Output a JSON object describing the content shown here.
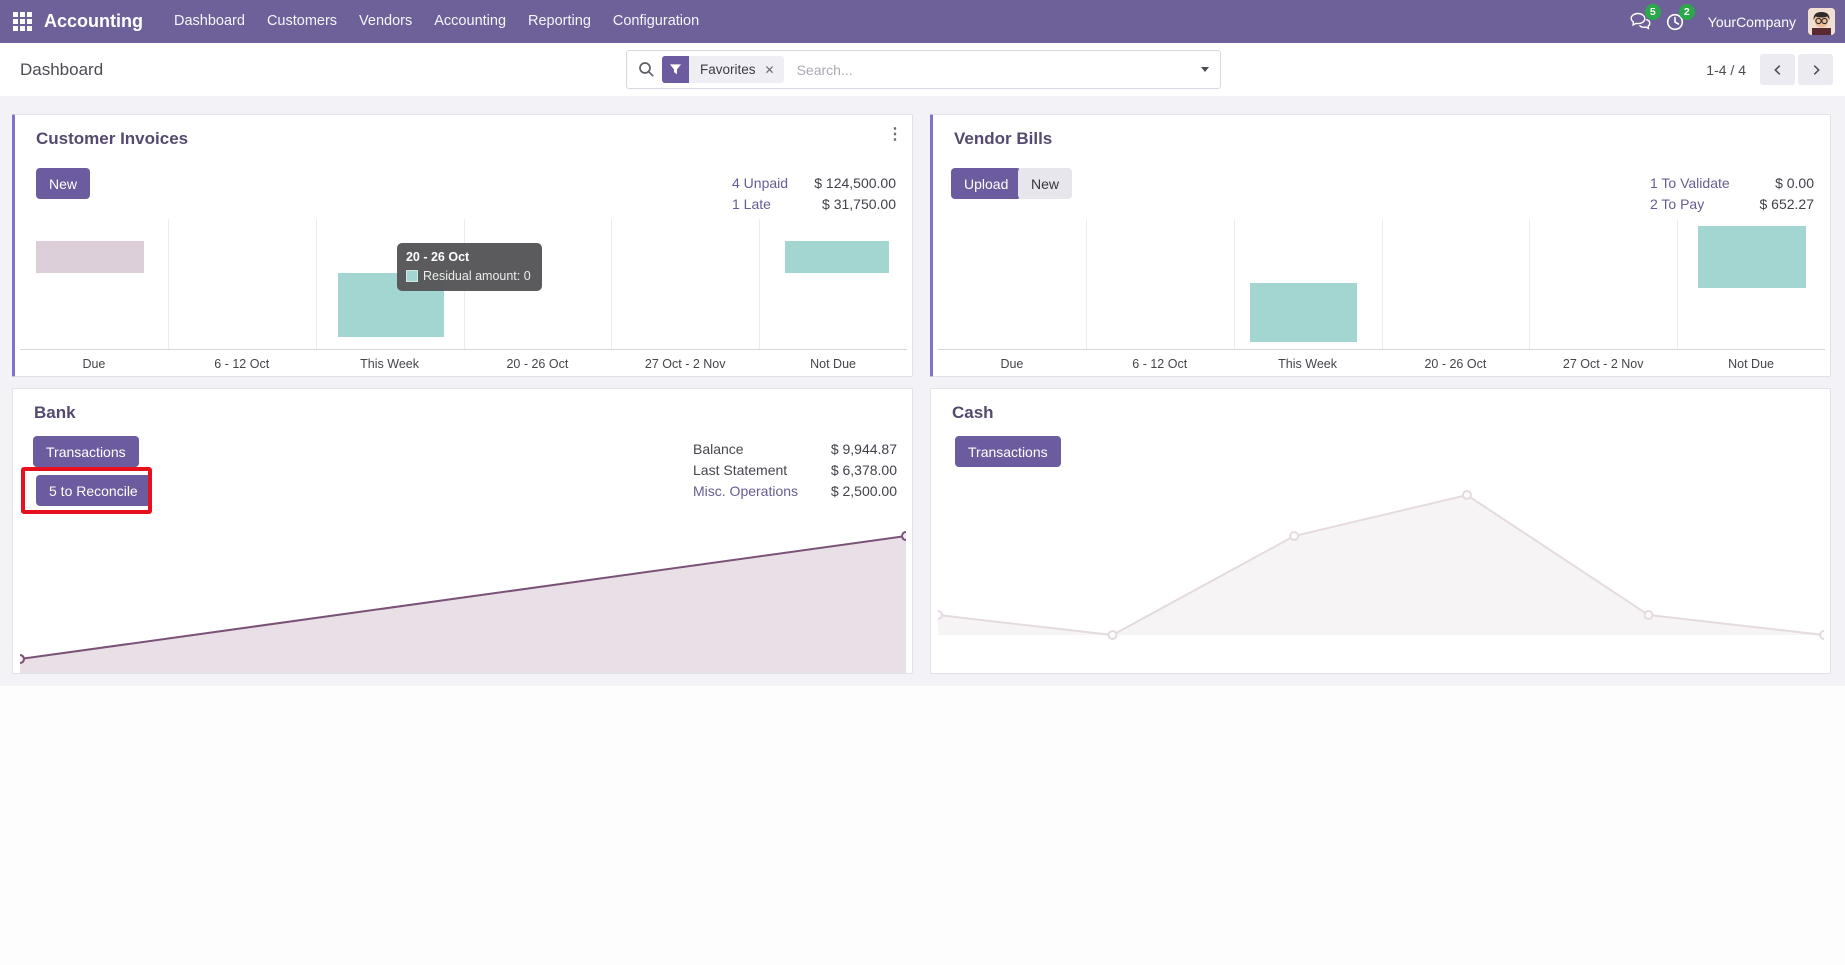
{
  "app": {
    "name": "Accounting",
    "nav_items": [
      "Dashboard",
      "Customers",
      "Vendors",
      "Accounting",
      "Reporting",
      "Configuration"
    ],
    "messages_count": "5",
    "activities_count": "2",
    "company_name": "YourCompany"
  },
  "control_panel": {
    "title": "Dashboard",
    "filter_tag": "Favorites",
    "search_placeholder": "Search...",
    "pager_text": "1-4 / 4"
  },
  "colors": {
    "nav_background": "#6e6199",
    "primary_button": "#6c5b9e",
    "card_accent_border": "#8172cc",
    "link_purple": "#685c93",
    "teal_bar": "#a3d6d1",
    "muted_bar": "#ddcfda",
    "bank_line": "#7b5277",
    "cash_line": "#e4dae0",
    "badge_green": "#2aa84a",
    "annotation_red": "#e8101e"
  },
  "cards": {
    "customer_invoices": {
      "title": "Customer Invoices",
      "new_button": "New",
      "stats": [
        {
          "label": "4 Unpaid",
          "value": "$ 124,500.00"
        },
        {
          "label": "1 Late",
          "value": "$ 31,750.00"
        }
      ],
      "chart": {
        "type": "bar",
        "categories": [
          "Due",
          "6 - 12 Oct",
          "This Week",
          "20 - 26 Oct",
          "27 Oct - 2 Nov",
          "Not Due"
        ],
        "series_name": "Residual amount",
        "bars": [
          {
            "category": "Due",
            "color": "#ddcfda",
            "x": 0.018,
            "w": 0.122,
            "top": 0.168,
            "h": 0.244
          },
          {
            "category": "This Week",
            "color": "#a3d6d1",
            "x": 0.358,
            "w": 0.12,
            "top": 0.412,
            "h": 0.496
          },
          {
            "category": "Not Due",
            "color": "#a3d6d1",
            "x": 0.863,
            "w": 0.117,
            "top": 0.168,
            "h": 0.244
          }
        ],
        "tooltip": {
          "title": "20 - 26 Oct",
          "label": "Residual amount: 0",
          "swatch_color": "#a3d6d1",
          "fx": 0.425,
          "fy": 0.185
        }
      }
    },
    "vendor_bills": {
      "title": "Vendor Bills",
      "upload_button": "Upload",
      "new_button": "New",
      "stats": [
        {
          "label": "1 To Validate",
          "value": "$ 0.00"
        },
        {
          "label": "2 To Pay",
          "value": "$ 652.27"
        }
      ],
      "chart": {
        "type": "bar",
        "categories": [
          "Due",
          "6 - 12 Oct",
          "This Week",
          "20 - 26 Oct",
          "27 Oct - 2 Nov",
          "Not Due"
        ],
        "series_name": "Residual amount",
        "bars": [
          {
            "category": "This Week",
            "color": "#a3d6d1",
            "x": 0.352,
            "w": 0.12,
            "top": 0.489,
            "h": 0.458
          },
          {
            "category": "Not Due",
            "color": "#a3d6d1",
            "x": 0.857,
            "w": 0.122,
            "top": 0.053,
            "h": 0.481
          }
        ]
      }
    },
    "bank": {
      "title": "Bank",
      "transactions_button": "Transactions",
      "reconcile_button": "5 to Reconcile",
      "annotation_color": "#e8101e",
      "stats": [
        {
          "label": "Balance",
          "value": "$ 9,944.87"
        },
        {
          "label": "Last Statement",
          "value": "$ 6,378.00"
        },
        {
          "label": "Misc. Operations",
          "value": "$ 2,500.00"
        }
      ],
      "chart": {
        "type": "line",
        "line_color": "#7b5277",
        "fill_color": "#e9dfe7",
        "marker_fill": "#f3ecf1",
        "line_points": [
          [
            0,
            0.931
          ],
          [
            1,
            0.322
          ]
        ],
        "fill_points": [
          [
            0,
            0.931
          ],
          [
            1,
            0.322
          ],
          [
            1,
            1
          ],
          [
            0,
            1
          ]
        ],
        "markers": [
          [
            0,
            0.931
          ],
          [
            1,
            0.322
          ]
        ]
      }
    },
    "cash": {
      "title": "Cash",
      "transactions_button": "Transactions",
      "chart": {
        "type": "line",
        "line_color": "#e4dae0",
        "fill_color": "#f7f4f6",
        "marker_fill": "#fdfcfd",
        "line_points": [
          [
            0,
            0.713
          ],
          [
            0.197,
            0.812
          ],
          [
            0.402,
            0.322
          ],
          [
            0.597,
            0.119
          ],
          [
            0.802,
            0.713
          ],
          [
            1,
            0.812
          ]
        ],
        "fill_points": [
          [
            0,
            0.713
          ],
          [
            0.197,
            0.812
          ],
          [
            0.402,
            0.322
          ],
          [
            0.597,
            0.119
          ],
          [
            0.802,
            0.713
          ],
          [
            1,
            0.812
          ],
          [
            0,
            0.812
          ]
        ],
        "markers": [
          [
            0,
            0.713
          ],
          [
            0.197,
            0.812
          ],
          [
            0.402,
            0.322
          ],
          [
            0.597,
            0.119
          ],
          [
            0.802,
            0.713
          ],
          [
            1,
            0.812
          ]
        ]
      }
    }
  }
}
